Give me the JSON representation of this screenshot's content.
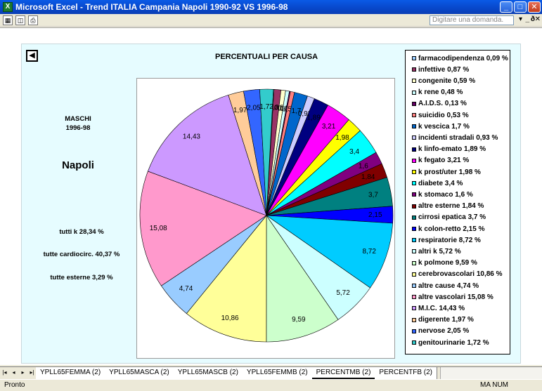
{
  "window": {
    "title": "Microsoft Excel - Trend ITALIA Campania Napoli 1990-92 VS 1996-98",
    "min": "_",
    "max": "□",
    "close": "✕"
  },
  "toolbar": {
    "help_placeholder": "Digitare una domanda.",
    "help_arrow": "▾",
    "doc_min": "_",
    "doc_max": "ð",
    "doc_close": "✕"
  },
  "chart": {
    "title": "PERCENTUALI PER CAUSA",
    "back_label": "◀",
    "group_label": "MASCHI",
    "period_label": "1996-98",
    "city_label": "Napoli",
    "summary": [
      "tutti k 28,34 %",
      "tutte cardiocirc. 40,37 %",
      "tutte esterne 3,29 %"
    ]
  },
  "chart_data": {
    "type": "pie",
    "slices": [
      {
        "label": "farmacodipendenza",
        "value": 0.09,
        "display": "0,09",
        "color": "#99ccff"
      },
      {
        "label": "infettive",
        "value": 0.87,
        "display": "0,87",
        "color": "#993366"
      },
      {
        "label": "congenite",
        "value": 0.59,
        "display": "0,59",
        "color": "#ffffcc"
      },
      {
        "label": "k rene",
        "value": 0.48,
        "display": "0,48",
        "color": "#ccffff"
      },
      {
        "label": "A.I.D.S.",
        "value": 0.13,
        "display": "0,13",
        "color": "#660066"
      },
      {
        "label": "suicidio",
        "value": 0.53,
        "display": "0,53",
        "color": "#ff8080"
      },
      {
        "label": "k vescica",
        "value": 1.7,
        "display": "1,7",
        "color": "#0066cc"
      },
      {
        "label": "incidenti stradali",
        "value": 0.93,
        "display": "0,93",
        "color": "#ccccff"
      },
      {
        "label": "k linfo-emato",
        "value": 1.89,
        "display": "1,89",
        "color": "#000080"
      },
      {
        "label": "k fegato",
        "value": 3.21,
        "display": "3,21",
        "color": "#ff00ff"
      },
      {
        "label": "k prost/uter",
        "value": 1.98,
        "display": "1,98",
        "color": "#ffff00"
      },
      {
        "label": "diabete",
        "value": 3.4,
        "display": "3,4",
        "color": "#00ffff"
      },
      {
        "label": "k stomaco",
        "value": 1.6,
        "display": "1,6",
        "color": "#800080"
      },
      {
        "label": "altre esterne",
        "value": 1.84,
        "display": "1,84",
        "color": "#800000"
      },
      {
        "label": "cirrosi epatica",
        "value": 3.7,
        "display": "3,7",
        "color": "#008080"
      },
      {
        "label": "k colon-retto",
        "value": 2.15,
        "display": "2,15",
        "color": "#0000ff"
      },
      {
        "label": "respiratorie",
        "value": 8.72,
        "display": "8,72",
        "color": "#00ccff"
      },
      {
        "label": "altri k",
        "value": 5.72,
        "display": "5,72",
        "color": "#ccffff"
      },
      {
        "label": "k polmone",
        "value": 9.59,
        "display": "9,59",
        "color": "#ccffcc"
      },
      {
        "label": "cerebrovascolari",
        "value": 10.86,
        "display": "10,86",
        "color": "#ffff99"
      },
      {
        "label": "altre cause",
        "value": 4.74,
        "display": "4,74",
        "color": "#99ccff"
      },
      {
        "label": "altre vascolari",
        "value": 15.08,
        "display": "15,08",
        "color": "#ff99cc"
      },
      {
        "label": "M.I.C.",
        "value": 14.43,
        "display": "14,43",
        "color": "#cc99ff"
      },
      {
        "label": "digerente",
        "value": 1.97,
        "display": "1,97",
        "color": "#ffcc99"
      },
      {
        "label": "nervose",
        "value": 2.05,
        "display": "2,05",
        "color": "#3366ff"
      },
      {
        "label": "genitourinarie",
        "value": 1.72,
        "display": "1,72",
        "color": "#33cccc"
      }
    ],
    "legend": [
      "farmacodipendenza 0,09 %",
      "infettive 0,87 %",
      "congenite 0,59 %",
      "k rene 0,48 %",
      "A.I.D.S. 0,13 %",
      "suicidio 0,53 %",
      "k vescica 1,7 %",
      "incidenti stradali 0,93 %",
      "k linfo-emato 1,89 %",
      "k fegato 3,21 %",
      "k prost/uter 1,98 %",
      "diabete 3,4 %",
      "k stomaco 1,6 %",
      "altre esterne 1,84 %",
      "cirrosi epatica 3,7 %",
      "k colon-retto 2,15 %",
      "respiratorie 8,72 %",
      "altri k 5,72 %",
      "k polmone 9,59 %",
      "cerebrovascolari 10,86 %",
      "altre cause 4,74 %",
      "altre vascolari 15,08 %",
      "M.I.C. 14,43 %",
      "digerente 1,97 %",
      "nervose 2,05 %",
      "genitourinarie 1,72 %"
    ],
    "legend_position": "right"
  },
  "tabs": {
    "nav": [
      "|◂",
      "◂",
      "▸",
      "▸|"
    ],
    "items": [
      "YPLL65FEMMA (2)",
      "YPLL65MASCA (2)",
      "YPLL65MASCB (2)",
      "YPLL65FEMMB (2)",
      "PERCENTMB (2)",
      "PERCENTFB (2)"
    ],
    "active_index": 4
  },
  "status": {
    "left": "Pronto",
    "right": "MA  NUM"
  }
}
